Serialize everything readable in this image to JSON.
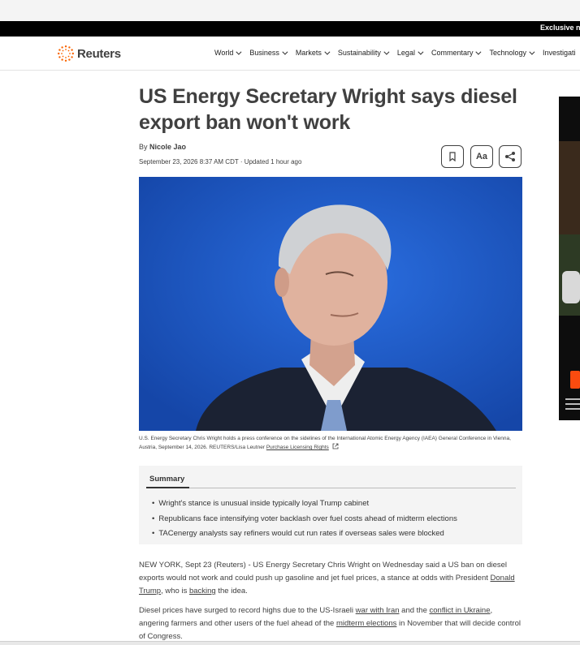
{
  "topbar": {
    "exclusive_text": "Exclusive ne"
  },
  "header": {
    "logo_text": "Reuters",
    "nav": [
      {
        "label": "World"
      },
      {
        "label": "Business"
      },
      {
        "label": "Markets"
      },
      {
        "label": "Sustainability"
      },
      {
        "label": "Legal"
      },
      {
        "label": "Commentary"
      },
      {
        "label": "Technology"
      },
      {
        "label": "Investigati"
      }
    ]
  },
  "article": {
    "headline": "US Energy Secretary Wright says diesel export ban won't work",
    "byline_prefix": "By",
    "author": "Nicole Jao",
    "dateline": "September 23, 2026 8:37 AM CDT · Updated 1 hour ago",
    "font_button_label": "Aa",
    "caption": "U.S. Energy Secretary Chris Wright holds a press conference on the sidelines of the International Atomic Energy Agency (IAEA) General Conference in Vienna, Austria, September 14, 2026. REUTERS/Lisa Leutner",
    "caption_link": "Purchase Licensing Rights",
    "summary": {
      "title": "Summary",
      "bullets": [
        "Wright's stance is unusual inside typically loyal Trump cabinet",
        "Republicans face intensifying voter backlash over fuel costs ahead of midterm elections",
        "TACenergy analysts say refiners would cut run rates if overseas sales were blocked"
      ]
    },
    "paragraph1": {
      "t1": "NEW YORK, Sept 23 (Reuters) - US Energy Secretary Chris Wright on Wednesday said a US ban on diesel exports would not work and could push up gasoline and jet fuel prices, a stance at odds with President ",
      "link1": "Donald Trump",
      "t2": ", who is ",
      "link2": "backing",
      "t3": " the idea."
    },
    "paragraph2": {
      "t1": "Diesel prices have surged to record highs due to the US-Israeli ",
      "link1": "war with Iran",
      "t2": " and the ",
      "link2": "conflict in Ukraine",
      "t3": ", angering farmers and other users of the fuel ahead of the ",
      "link3": "midterm elections",
      "t4": " in November that will decide control of Congress."
    }
  },
  "colors": {
    "accent_orange": "#fa6400",
    "photo_background": "#1a56c4",
    "text": "#404040"
  }
}
